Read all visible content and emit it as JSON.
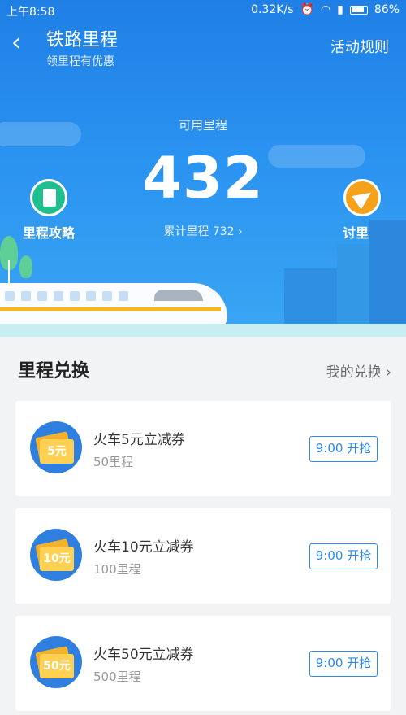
{
  "status_bar": {
    "time": "上午8:58",
    "speed": "0.32K/s",
    "battery": "86%"
  },
  "header": {
    "title": "铁路里程",
    "subtitle": "领里程有优惠",
    "rules_label": "活动规则"
  },
  "miles": {
    "available_label": "可用里程",
    "available_value": "432",
    "total_label": "累计里程 732",
    "total_chevron": "›"
  },
  "quick_links": {
    "strategy_label": "里程攻略",
    "ask_label": "讨里程"
  },
  "exchange": {
    "title": "里程兑换",
    "my_exchange_label": "我的兑换 ›",
    "items": [
      {
        "coupon": "5元",
        "name": "火车5元立减券",
        "cost": "50里程",
        "button": "9:00 开抢"
      },
      {
        "coupon": "10元",
        "name": "火车10元立减券",
        "cost": "100里程",
        "button": "9:00 开抢"
      },
      {
        "coupon": "50元",
        "name": "火车50元立减券",
        "cost": "500里程",
        "button": "9:00 开抢"
      }
    ]
  },
  "colors": {
    "hero_blue": "#2a92f0",
    "accent_blue": "#2b8be8",
    "coupon_yellow": "#ffd051",
    "strategy_green": "#1fbf8f",
    "ask_orange": "#f6a11a"
  },
  "icons": {
    "back": "chevron-left-icon",
    "alarm": "alarm-icon",
    "wifi": "wifi-icon",
    "signal": "signal-icon",
    "battery": "battery-icon"
  }
}
